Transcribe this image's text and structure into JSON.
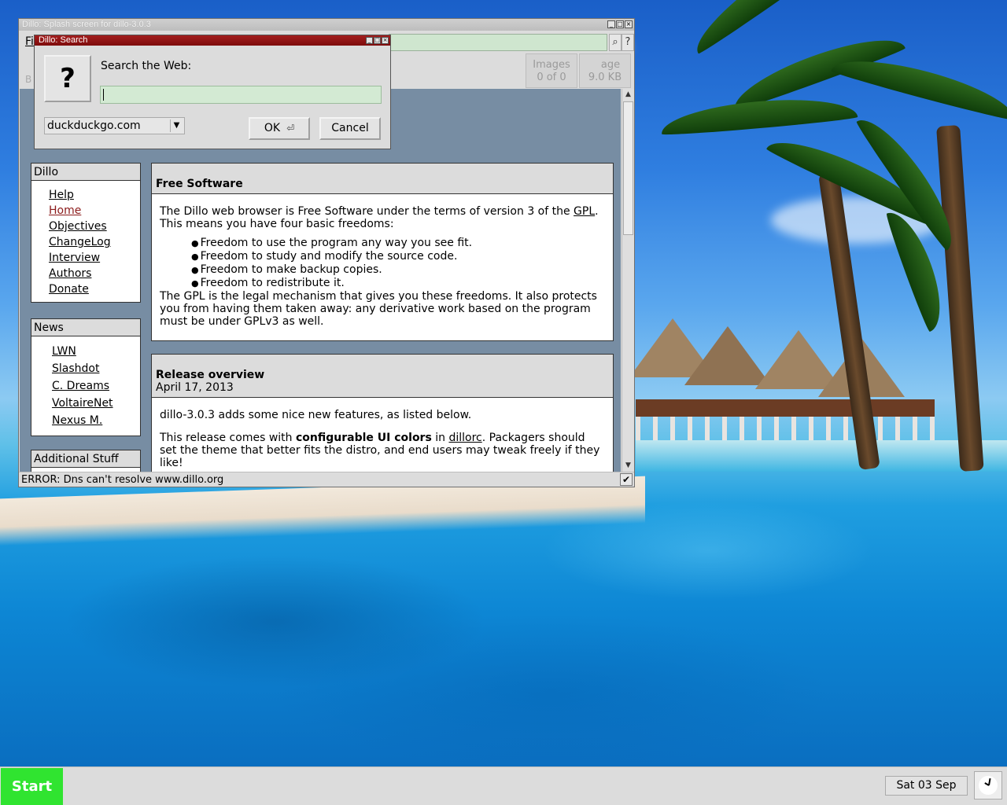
{
  "desktop": {
    "wallpaper": "tropical-beach-pool-palms",
    "colors": {
      "sea": "#0d86d4",
      "sky": "#1a5fc8",
      "start": "#30e430"
    }
  },
  "dillo_window": {
    "title": "Dillo: Splash screen for dillo-3.0.3",
    "menu_file": "Fi",
    "info": {
      "images_label": "Images",
      "images_value": "0 of 0",
      "page_label": "age",
      "page_value": "9.0 KB"
    },
    "nav_hint": "B",
    "status": "ERROR: Dns can't resolve www.dillo.org",
    "status_button": "✔"
  },
  "sidebar": {
    "dillo": {
      "title": "Dillo",
      "items": [
        "Help",
        "Home",
        "Objectives",
        "ChangeLog",
        "Interview",
        "Authors",
        "Donate"
      ]
    },
    "news": {
      "title": "News",
      "items": [
        "LWN",
        "Slashdot",
        "C. Dreams",
        "VoltaireNet",
        "Nexus M."
      ]
    },
    "additional": {
      "title": "Additional Stuff"
    }
  },
  "free_software": {
    "title": "Free Software",
    "intro_pre": "The Dillo web browser is Free Software under the terms of version 3 of the ",
    "intro_link": "GPL",
    "intro_post": ".",
    "intro2": "This means you have four basic freedoms:",
    "freedoms": [
      "Freedom to use the program any way you see fit.",
      "Freedom to study and modify the source code.",
      "Freedom to make backup copies.",
      "Freedom to redistribute it."
    ],
    "outro": "The GPL is the legal mechanism that gives you these freedoms. It also protects you from having them taken away: any derivative work based on the program must be under GPLv3 as well."
  },
  "release": {
    "title": "Release overview",
    "date": "April 17, 2013",
    "line1": "dillo-3.0.3 adds some nice new features, as listed below.",
    "line2_pre": "This release comes with ",
    "line2_bold": "configurable UI colors",
    "line2_mid": " in ",
    "line2_link": "dillorc",
    "line2_post": ". Packagers should set the theme that better fits the distro, and end users may tweak freely if they like!"
  },
  "search_dialog": {
    "title": "Dillo: Search",
    "icon": "?",
    "label": "Search the Web:",
    "input_value": "",
    "engine": "duckduckgo.com",
    "ok": "OK",
    "ok_icon": "⏎",
    "cancel": "Cancel"
  },
  "taskbar": {
    "start": "Start",
    "date": "Sat 03 Sep"
  }
}
